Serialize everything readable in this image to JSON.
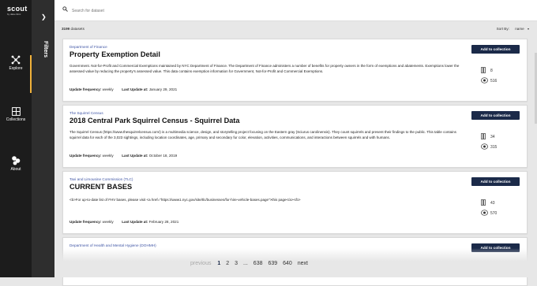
{
  "app": {
    "name": "scout",
    "tagline": "by data clinic"
  },
  "nav": {
    "explore": "Explore",
    "collections": "Collections",
    "about": "About"
  },
  "filters": {
    "label": "Filters"
  },
  "search": {
    "placeholder": "Search for dataset"
  },
  "results": {
    "count": "3199",
    "count_suffix": "datasets",
    "sort_label": "Sort By:",
    "sort_value": "name"
  },
  "card_ui": {
    "add_label": "Add to collection",
    "frequency_label": "Update frequency:",
    "last_update_label": "Last Update at:"
  },
  "datasets": [
    {
      "publisher": "Department of Finance",
      "title": "Property Exemption Detail",
      "description": "Government. Not-for-Profit and Commercial Exemptions maintained by NYC Department of Finance. The Department of Finance administers a number of benefits for property owners in the form of exemptions and abatements. Exemptions lower the assessed value by reducing the property's assessed value. This data contains exemption information for Government, Not-for-Profit and Commercial Exemptions.",
      "frequency": "weekly",
      "last_update": "January 29, 2021",
      "columns": "8",
      "views": "516"
    },
    {
      "publisher": "The Squirrel Census",
      "title": "2018 Central Park Squirrel Census - Squirrel Data",
      "description": "The Squirrel Census (https://www.thesquirrelcensus.com/) is a multimedia science, design, and storytelling project focusing on the Eastern gray (Sciurus carolinensis). They count squirrels and present their findings to the public. This table contains squirrel data for each of the 3,023 sightings, including location coordinates, age, primary and secondary fur color, elevation, activities, communications, and interactions between squirrels and with humans.",
      "frequency": "weekly",
      "last_update": "October 18, 2019",
      "columns": "34",
      "views": "315"
    },
    {
      "publisher": "Taxi and Limousine Commission (TLC)",
      "title": "CURRENT BASES",
      "description": "<b>For up-to-date list of FHV bases, please visit <a href=\"https://www1.nyc.gov/site/tlc/businesses/for-hire-vehicle-bases.page\">this page</a></b>",
      "frequency": "weekly",
      "last_update": "February 28, 2021",
      "columns": "43",
      "views": "570"
    },
    {
      "publisher": "Department of Health and Mental Hygiene (DOHMH)",
      "title": "",
      "description": "",
      "frequency": "",
      "last_update": "",
      "columns": "",
      "views": ""
    }
  ],
  "pagination": {
    "previous": "previous",
    "pages": [
      "1",
      "2",
      "3",
      "...",
      "638",
      "639",
      "640"
    ],
    "next": "next"
  },
  "colors": {
    "sidebar": "#1c1c1c",
    "filters_panel": "#2e2e2e",
    "accent": "#f2b23a",
    "button": "#1b2a49",
    "publisher_link": "#3f55a5"
  }
}
